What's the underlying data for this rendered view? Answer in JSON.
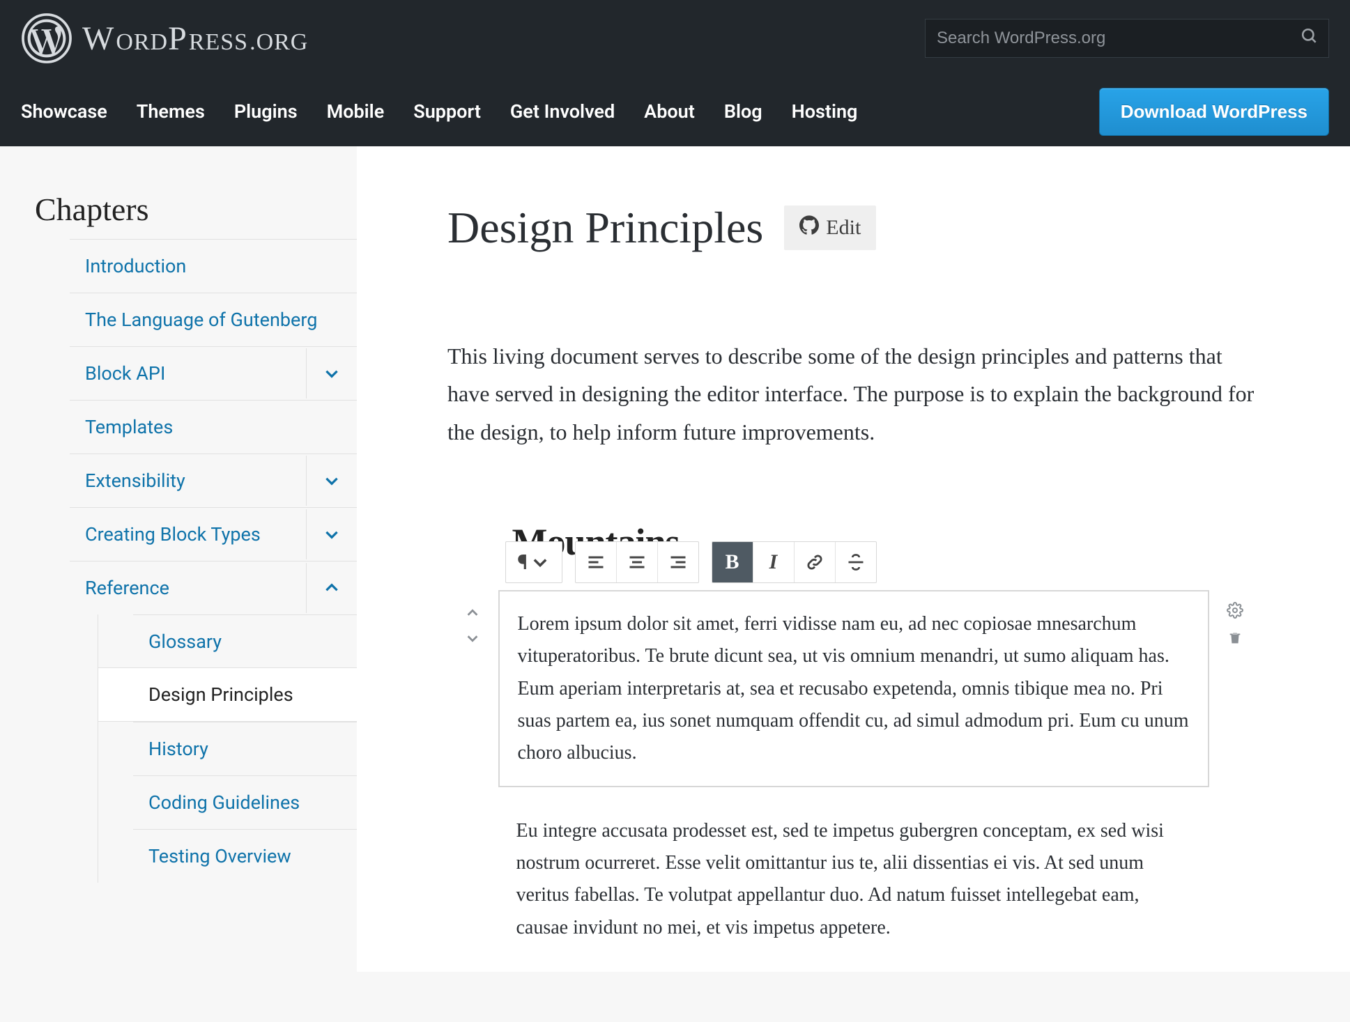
{
  "header": {
    "logo_main": "WordPress",
    "logo_tail": ".ORG",
    "search_placeholder": "Search WordPress.org",
    "nav": [
      "Showcase",
      "Themes",
      "Plugins",
      "Mobile",
      "Support",
      "Get Involved",
      "About",
      "Blog",
      "Hosting"
    ],
    "download_label": "Download WordPress"
  },
  "sidebar": {
    "title": "Chapters",
    "items": [
      {
        "label": "Introduction",
        "expandable": false
      },
      {
        "label": "The Language of Gutenberg",
        "expandable": false
      },
      {
        "label": "Block API",
        "expandable": true,
        "expanded": false
      },
      {
        "label": "Templates",
        "expandable": false
      },
      {
        "label": "Extensibility",
        "expandable": true,
        "expanded": false
      },
      {
        "label": "Creating Block Types",
        "expandable": true,
        "expanded": false
      },
      {
        "label": "Reference",
        "expandable": true,
        "expanded": true,
        "children": [
          {
            "label": "Glossary",
            "active": false
          },
          {
            "label": "Design Principles",
            "active": true
          },
          {
            "label": "History",
            "active": false
          },
          {
            "label": "Coding Guidelines",
            "active": false
          },
          {
            "label": "Testing Overview",
            "active": false
          }
        ]
      }
    ]
  },
  "page": {
    "title": "Design Principles",
    "edit_label": "Edit",
    "intro": "This living document serves to describe some of the design principles and patterns that have served in designing the editor interface. The purpose is to explain the background for the design, to help inform future improvements."
  },
  "editor": {
    "heading": "Mountains",
    "toolbar": {
      "para_glyph": "¶",
      "bold_glyph": "B",
      "italic_glyph": "I"
    },
    "selected_paragraph": "Lorem ipsum dolor sit amet, ferri vidisse nam eu, ad nec copiosae mnesarchum vituperatoribus. Te brute dicunt sea, ut vis omnium menandri, ut sumo aliquam has. Eum aperiam interpretaris at, sea et recusabo expetenda, omnis tibique mea no. Pri suas partem ea, ius sonet numquam offendit cu, ad simul admodum pri. Eum cu unum choro albucius.",
    "next_paragraph": "Eu integre accusata prodesset est, sed te impetus gubergren conceptam, ex sed wisi nostrum ocurreret. Esse velit omittantur ius te, alii dissentias ei vis. At sed unum veritus fabellas. Te volutpat appellantur duo. Ad natum fuisset intellegebat eam, causae invidunt no mei, et vis impetus appetere."
  }
}
